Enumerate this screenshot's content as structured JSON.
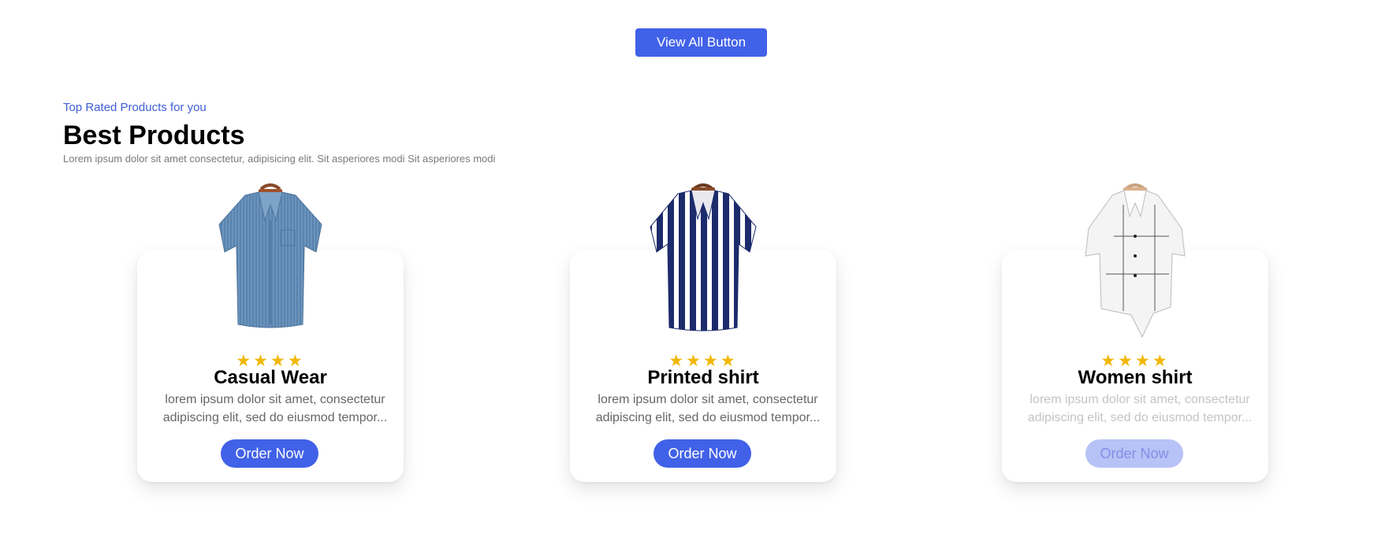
{
  "view_all_label": "View All Button",
  "section": {
    "subtitle": "Top Rated Products for you",
    "title": "Best Products",
    "description": "Lorem ipsum dolor sit amet consectetur, adipisicing elit. Sit asperiores modi Sit asperiores modi"
  },
  "products": [
    {
      "name": "Casual Wear",
      "rating": 4,
      "stars": "★★★★",
      "description": "lorem ipsum dolor sit amet, consectetur adipiscing elit, sed do eiusmod tempor...",
      "button": "Order Now"
    },
    {
      "name": "Printed shirt",
      "rating": 4,
      "stars": "★★★★",
      "description": "lorem ipsum dolor sit amet, consectetur adipiscing elit, sed do eiusmod tempor...",
      "button": "Order Now"
    },
    {
      "name": "Women shirt",
      "rating": 4,
      "stars": "★★★★",
      "description": "lorem ipsum dolor sit amet, consectetur adipiscing elit, sed do eiusmod tempor...",
      "button": "Order Now"
    }
  ],
  "colors": {
    "accent": "#4161e8",
    "subtitle": "#3f5fd6",
    "star": "#f2b705",
    "faded_button": "#b7c2f6"
  }
}
